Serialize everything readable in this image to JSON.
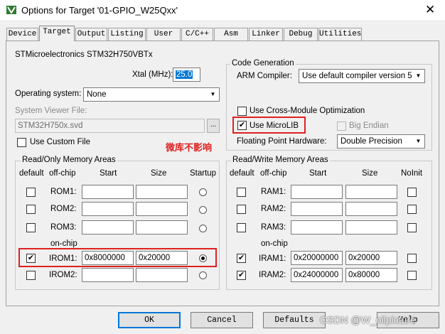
{
  "window": {
    "title": "Options for Target '01-GPIO_W25Qxx'",
    "close_glyph": "✕"
  },
  "tabs": [
    {
      "label": "Device"
    },
    {
      "label": "Target"
    },
    {
      "label": "Output"
    },
    {
      "label": "Listing"
    },
    {
      "label": "User"
    },
    {
      "label": "C/C++"
    },
    {
      "label": "Asm"
    },
    {
      "label": "Linker"
    },
    {
      "label": "Debug"
    },
    {
      "label": "Utilities"
    }
  ],
  "target": {
    "device_name": "STMicroelectronics STM32H750VBTx",
    "xtal_label": "Xtal (MHz):",
    "xtal_value": "25.0",
    "os_label": "Operating system:",
    "os_value": "None",
    "svf_label": "System Viewer File:",
    "svf_value": "STM32H750x.svd",
    "browse_label": "...",
    "custom_file_label": "Use Custom File",
    "annotation": "微库不影响"
  },
  "codegen": {
    "title": "Code Generation",
    "compiler_label": "ARM Compiler:",
    "compiler_value": "Use default compiler version 5",
    "cross_module_label": "Use Cross-Module Optimization",
    "microlib_label": "Use MicroLIB",
    "microlib_mark": "✔",
    "big_endian_label": "Big Endian",
    "fph_label": "Floating Point Hardware:",
    "fph_value": "Double Precision"
  },
  "ro": {
    "title": "Read/Only Memory Areas",
    "headers": {
      "default": "default",
      "offchip": "off-chip",
      "start": "Start",
      "size": "Size",
      "startup": "Startup"
    },
    "onchip_label": "on-chip",
    "rows": [
      {
        "name": "ROM1:",
        "start": "",
        "size": "",
        "default_mark": ""
      },
      {
        "name": "ROM2:",
        "start": "",
        "size": "",
        "default_mark": ""
      },
      {
        "name": "ROM3:",
        "start": "",
        "size": "",
        "default_mark": ""
      },
      {
        "name": "IROM1:",
        "start": "0x8000000",
        "size": "0x20000",
        "default_mark": "✔"
      },
      {
        "name": "IROM2:",
        "start": "",
        "size": "",
        "default_mark": ""
      }
    ]
  },
  "rw": {
    "title": "Read/Write Memory Areas",
    "headers": {
      "default": "default",
      "offchip": "off-chip",
      "start": "Start",
      "size": "Size",
      "noinit": "NoInit"
    },
    "onchip_label": "on-chip",
    "rows": [
      {
        "name": "RAM1:",
        "start": "",
        "size": "",
        "default_mark": ""
      },
      {
        "name": "RAM2:",
        "start": "",
        "size": "",
        "default_mark": ""
      },
      {
        "name": "RAM3:",
        "start": "",
        "size": "",
        "default_mark": ""
      },
      {
        "name": "IRAM1:",
        "start": "0x20000000",
        "size": "0x20000",
        "default_mark": "✔"
      },
      {
        "name": "IRAM2:",
        "start": "0x24000000",
        "size": "0x80000",
        "default_mark": "✔"
      }
    ]
  },
  "buttons": {
    "ok": "OK",
    "cancel": "Cancel",
    "defaults": "Defaults",
    "help": "Help"
  },
  "watermark": "CSDN @W_oilpicture",
  "icons": {
    "dropdown": "▼",
    "app": "keil-uvision-icon"
  },
  "colors": {
    "accent": "#0078d7",
    "annotation": "#e02020"
  }
}
